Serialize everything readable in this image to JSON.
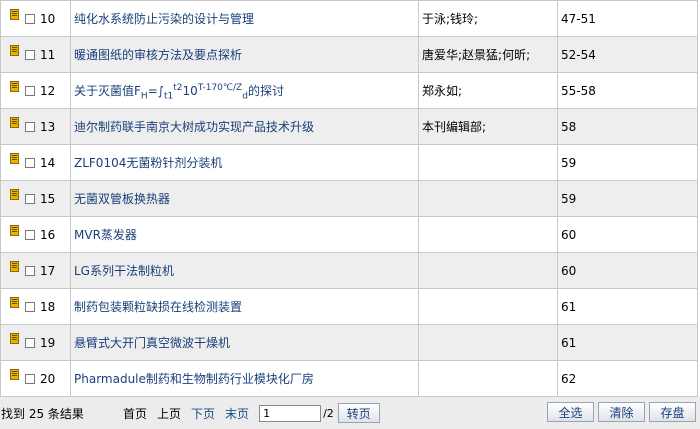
{
  "rows": [
    {
      "num": "10",
      "title": "纯化水系统防止污染的设计与管理",
      "authors": "于泳;钱玲;",
      "pages": "47-51"
    },
    {
      "num": "11",
      "title": "暖通图纸的审核方法及要点探析",
      "authors": "唐爱华;赵景猛;何昕;",
      "pages": "52-54"
    },
    {
      "num": "12",
      "title_parts": {
        "pre": "关于灭菌值F",
        "sub1": "H",
        "mid1": "=∫",
        "sub2": "t1",
        "sup1": "t2",
        "mid2": "10",
        "sup2": "T-170℃/Z",
        "sub3": "d",
        "post": "的探讨"
      },
      "authors": "郑永如;",
      "pages": "55-58"
    },
    {
      "num": "13",
      "title": "迪尔制药联手南京大树成功实现产品技术升级",
      "authors": "本刊编辑部;",
      "pages": "58"
    },
    {
      "num": "14",
      "title": "ZLF0104无菌粉针剂分装机",
      "authors": "",
      "pages": "59"
    },
    {
      "num": "15",
      "title": "无菌双管板换热器",
      "authors": "",
      "pages": "59"
    },
    {
      "num": "16",
      "title": "MVR蒸发器",
      "authors": "",
      "pages": "60"
    },
    {
      "num": "17",
      "title": "LG系列干法制粒机",
      "authors": "",
      "pages": "60"
    },
    {
      "num": "18",
      "title": "制药包装颗粒缺损在线检测装置",
      "authors": "",
      "pages": "61"
    },
    {
      "num": "19",
      "title": "悬臂式大开门真空微波干燥机",
      "authors": "",
      "pages": "61"
    },
    {
      "num": "20",
      "title": "Pharmadule制药和生物制药行业模块化厂房",
      "authors": "",
      "pages": "62"
    }
  ],
  "footer": {
    "found_text": "找到 25 条结果",
    "first_page": "首页",
    "prev_page": "上页",
    "next_page": "下页",
    "last_page": "末页",
    "page_value": "1",
    "total_pages": "/2",
    "go_button": "转页",
    "select_all": "全选",
    "clear": "清除",
    "save": "存盘"
  },
  "colors": {
    "link": "#1a3f7a",
    "row_alt": "#eeeeee",
    "icon": "#e8b400"
  }
}
